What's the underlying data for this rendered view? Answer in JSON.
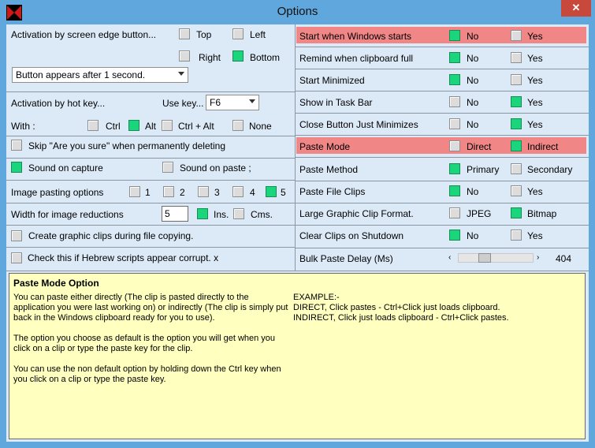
{
  "window": {
    "title": "Options",
    "close_label": "✕"
  },
  "left": {
    "activation_edge_label": "Activation by screen edge button...",
    "edge_top": "Top",
    "edge_left": "Left",
    "edge_right": "Right",
    "edge_bottom": "Bottom",
    "button_appears_select": "Button appears after 1 second.",
    "activation_hotkey_label": "Activation by hot key...",
    "use_key_label": "Use key...",
    "use_key_value": "F6",
    "with_label": "With  :",
    "mod_ctrl": "Ctrl",
    "mod_alt": "Alt",
    "mod_ctrl_alt": "Ctrl + Alt",
    "mod_none": "None",
    "skip_label": "Skip \"Are you sure\" when permanently deleting",
    "sound_capture": "Sound on capture",
    "sound_paste": "Sound on paste ;",
    "image_pasting_label": "Image pasting options",
    "img_opt_1": "1",
    "img_opt_2": "2",
    "img_opt_3": "3",
    "img_opt_4": "4",
    "img_opt_5": "5",
    "width_label": "Width for image reductions",
    "width_value": "5",
    "unit_ins": "Ins.",
    "unit_cms": "Cms.",
    "create_graphic_label": "Create graphic clips during file copying.",
    "hebrew_label": "Check this if Hebrew scripts appear corrupt. x"
  },
  "right": {
    "rows": [
      {
        "label": "Start when Windows starts",
        "opt1": "No",
        "opt2": "Yes"
      },
      {
        "label": "Remind when clipboard full",
        "opt1": "No",
        "opt2": "Yes"
      },
      {
        "label": "Start Minimized",
        "opt1": "No",
        "opt2": "Yes"
      },
      {
        "label": "Show in Task Bar",
        "opt1": "No",
        "opt2": "Yes"
      },
      {
        "label": "Close Button Just Minimizes",
        "opt1": "No",
        "opt2": "Yes"
      },
      {
        "label": "Paste Mode",
        "opt1": "Direct",
        "opt2": "Indirect"
      },
      {
        "label": "Paste Method",
        "opt1": "Primary",
        "opt2": "Secondary"
      },
      {
        "label": "Paste File Clips",
        "opt1": "No",
        "opt2": "Yes"
      },
      {
        "label": "Large Graphic Clip Format.",
        "opt1": "JPEG",
        "opt2": "Bitmap"
      },
      {
        "label": "Clear Clips on Shutdown",
        "opt1": "No",
        "opt2": "Yes"
      }
    ],
    "bulk_label": "Bulk Paste Delay (Ms)",
    "bulk_value": "404",
    "bulk_slider_fraction": 0.32
  },
  "help": {
    "heading": "Paste Mode Option",
    "para1": "You can paste either directly (The clip is pasted directly to the\napplication you were last working on) or indirectly (The clip is simply put\nback in the Windows clipboard ready for you to use).",
    "para2": "The option you choose as default is the option you will get when you\nclick on a clip or type the paste key for the clip.",
    "para3": "You can use the non default option by holding down the Ctrl key when\nyou click on a clip or type the paste key.",
    "example": "EXAMPLE:-\nDIRECT, Click pastes - Ctrl+Click just loads clipboard.\nINDIRECT, Click just loads clipboard - Ctrl+Click pastes."
  },
  "colors": {
    "accent_on": "#19d67c",
    "highlight": "#f08686",
    "help_bg": "#ffffc0",
    "panel_bg": "#dce9f7"
  }
}
